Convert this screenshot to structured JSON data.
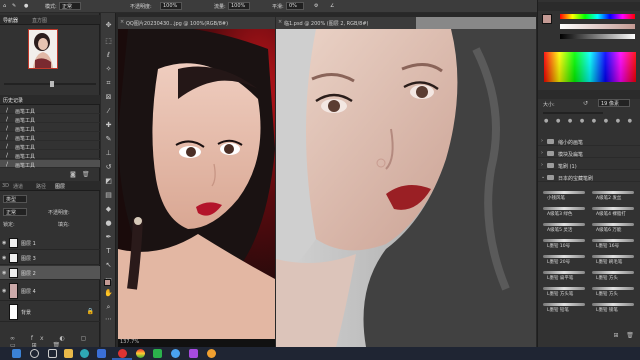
{
  "options_bar": {
    "mode_label": "模式:",
    "mode_value": "正常",
    "opacity_label": "不透明度:",
    "opacity_value": "100%",
    "flow_label": "流量:",
    "flow_value": "100%",
    "smooth_label": "平滑:",
    "smooth_value": "0%"
  },
  "navigator": {
    "tabs": [
      {
        "label": "导航器",
        "active": true
      },
      {
        "label": "直方图",
        "active": false
      }
    ]
  },
  "history": {
    "tab_label": "历史记录",
    "items": [
      {
        "label": "画笔工具",
        "selected": false
      },
      {
        "label": "画笔工具",
        "selected": false
      },
      {
        "label": "画笔工具",
        "selected": false
      },
      {
        "label": "画笔工具",
        "selected": false
      },
      {
        "label": "画笔工具",
        "selected": false
      },
      {
        "label": "画笔工具",
        "selected": false
      },
      {
        "label": "画笔工具",
        "selected": true
      }
    ]
  },
  "layers": {
    "tabs": [
      {
        "label": "3D",
        "active": false
      },
      {
        "label": "通道",
        "active": false
      },
      {
        "label": "路径",
        "active": false
      },
      {
        "label": "图层",
        "active": true
      }
    ],
    "kind_value": "类型",
    "blend_value": "正常",
    "opacity_label": "不透明度:",
    "lock_label": "锁定:",
    "fill_label": "填充:",
    "items": [
      {
        "name": "图层 1",
        "selected": false
      },
      {
        "name": "图层 3",
        "selected": false
      },
      {
        "name": "图层 2",
        "selected": true
      },
      {
        "name": "图层 4",
        "selected": false
      },
      {
        "name": "背景",
        "selected": false
      }
    ]
  },
  "documents": {
    "ref_tab": "QQ图片20230430...jpg @ 100%(RGB/8#)",
    "ref_zoom": "137.7%",
    "work_tab": "临1.psd @ 200% (图层 2, RGB/8#)"
  },
  "brushes": {
    "size_label": "大小:",
    "size_value": "19 像素",
    "groups": [
      {
        "label": "缩小的画笔",
        "open": false
      },
      {
        "label": "模块及扁笔",
        "open": false
      },
      {
        "label": "笔刷 (1)",
        "open": false
      },
      {
        "label": "日本的宝藏笔刷",
        "open": true
      }
    ],
    "items": [
      "小钱风笔",
      "A级笔2 发丝",
      "A级笔3 绿色",
      "A级笔4 裸脂打",
      "A级笔5 灵活",
      "A级笔6 万能",
      "L墨铅 10号",
      "L墨铅 16号",
      "L墨铅 20号",
      "L墨铅 刷毛笔",
      "L墨铅 扁平笔",
      "L墨铅 方头",
      "L墨铅 方头笔",
      "L墨铅 方头",
      "L墨铅 铅笔",
      "L墨铅 锁笔"
    ]
  },
  "colors": {
    "accent": "#2f5fb3",
    "foreground": "#c49a94",
    "background": "#ffffff"
  },
  "taskbar": {
    "icons": [
      "windows-start-icon",
      "search-icon",
      "task-view-icon",
      "folder-icon",
      "edge-icon",
      "app-icon",
      "photoshop-icon",
      "chrome-icon",
      "wechat-icon",
      "qq-icon",
      "paint-icon",
      "app-icon-2"
    ]
  }
}
